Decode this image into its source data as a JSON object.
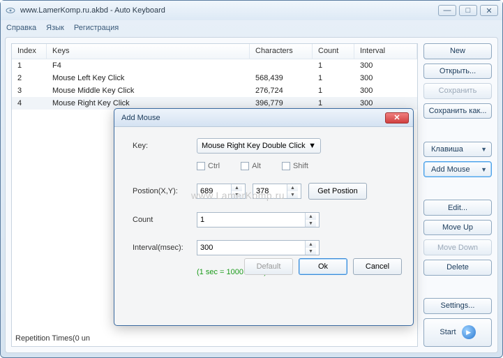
{
  "title": "www.LamerKomp.ru.akbd - Auto Keyboard",
  "menu": [
    "Справка",
    "Язык",
    "Регистрация"
  ],
  "table": {
    "headers": {
      "index": "Index",
      "keys": "Keys",
      "chars": "Characters",
      "count": "Count",
      "interval": "Interval"
    },
    "rows": [
      {
        "index": "1",
        "keys": "F4",
        "chars": "",
        "count": "1",
        "interval": "300"
      },
      {
        "index": "2",
        "keys": "Mouse Left Key Click",
        "chars": "568,439",
        "count": "1",
        "interval": "300"
      },
      {
        "index": "3",
        "keys": "Mouse Middle Key Click",
        "chars": "276,724",
        "count": "1",
        "interval": "300"
      },
      {
        "index": "4",
        "keys": "Mouse Right Key Click",
        "chars": "396,779",
        "count": "1",
        "interval": "300"
      }
    ]
  },
  "sidebar": {
    "new": "New",
    "open": "Открыть...",
    "save": "Сохранить",
    "saveas": "Сохранить как...",
    "key": "Клавиша",
    "addmouse": "Add Mouse",
    "edit": "Edit...",
    "moveup": "Move Up",
    "movedown": "Move Down",
    "delete": "Delete",
    "settings": "Settings...",
    "start": "Start"
  },
  "footer": "Repetition Times(0 un",
  "dialog": {
    "title": "Add Mouse",
    "key_label": "Key:",
    "key_value": "Mouse Right Key Double Click",
    "ctrl": "Ctrl",
    "alt": "Alt",
    "shift": "Shift",
    "watermark": "www.LamerKomp.ru",
    "pos_label": "Postion(X,Y):",
    "pos_x": "689",
    "pos_y": "378",
    "getpos": "Get Postion",
    "count_label": "Count",
    "count_value": "1",
    "interval_label": "Interval(msec):",
    "interval_value": "300",
    "hint": "(1 sec = 1000 msec)",
    "default": "Default",
    "ok": "Ok",
    "cancel": "Cancel"
  }
}
